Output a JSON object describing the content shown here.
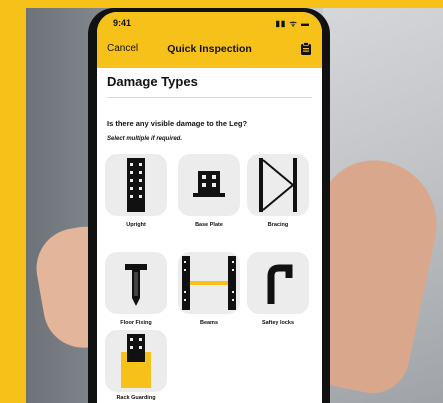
{
  "status_bar": {
    "time": "9:41",
    "indicators": "▮▮ ᯤ ▬"
  },
  "nav": {
    "cancel_label": "Cancel",
    "title": "Quick Inspection",
    "action_icon": "clipboard-icon"
  },
  "section": {
    "title": "Damage Types"
  },
  "form": {
    "question": "Is there any visible damage to the Leg?",
    "hint": "Select multiple if required."
  },
  "damage_types": [
    {
      "label": "Upright",
      "icon": "upright-icon"
    },
    {
      "label": "Base Plate",
      "icon": "base-plate-icon"
    },
    {
      "label": "Bracing",
      "icon": "bracing-icon"
    },
    {
      "label": "Floor Fixing",
      "icon": "floor-fixing-icon"
    },
    {
      "label": "Beams",
      "icon": "beams-icon"
    },
    {
      "label": "Saftey locks",
      "icon": "safety-lock-icon"
    },
    {
      "label": "Rack Guarding",
      "icon": "rack-guarding-icon"
    }
  ],
  "colors": {
    "accent": "#f6c21a",
    "tile": "#ececec",
    "text": "#111111"
  }
}
